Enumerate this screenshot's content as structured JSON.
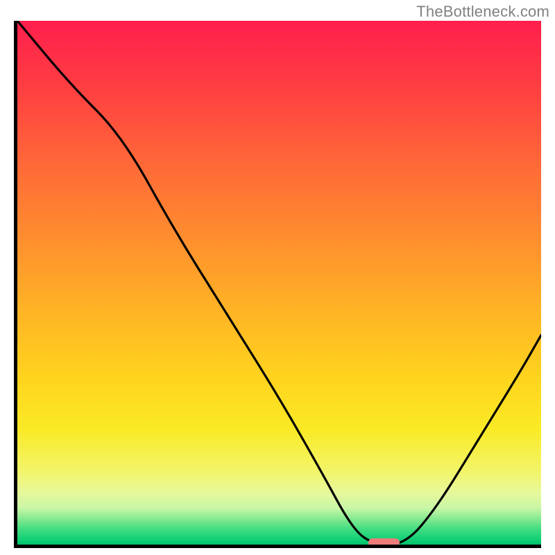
{
  "attribution": "TheBottleneck.com",
  "colors": {
    "top": "#ff1f4d",
    "bottom": "#04c06d",
    "curve": "#000000",
    "marker": "#ee7c7a"
  },
  "chart_data": {
    "type": "line",
    "title": "",
    "xlabel": "",
    "ylabel": "",
    "xlim": [
      0,
      100
    ],
    "ylim": [
      0,
      100
    ],
    "series": [
      {
        "name": "bottleneck-curve",
        "x": [
          0,
          10,
          20,
          30,
          40,
          50,
          58,
          64,
          68,
          74,
          80,
          88,
          96,
          100
        ],
        "y": [
          100,
          88,
          78,
          60,
          44,
          28,
          14,
          3,
          0,
          0,
          7,
          20,
          33,
          40
        ]
      }
    ],
    "annotations": [
      {
        "name": "optimal-marker",
        "x": 70,
        "width_pct": 6,
        "y": 0
      }
    ],
    "background_gradient": {
      "top_color": "#ff1f4d",
      "bottom_color": "#04c06d",
      "meaning": "red=worse, green=better"
    }
  }
}
